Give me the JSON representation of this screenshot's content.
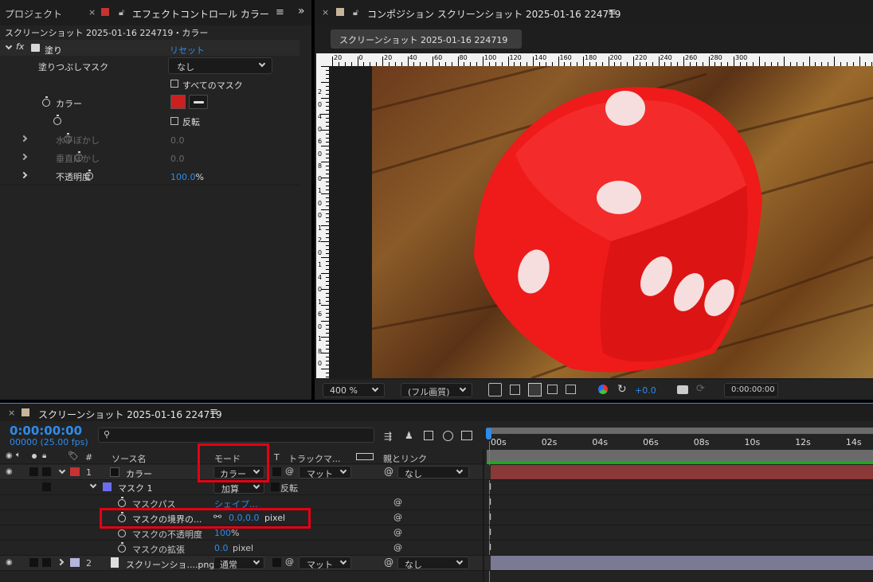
{
  "project_tab": "プロジェクト",
  "effect_tab": "エフェクトコントロール カラー",
  "effect_subtitle": "スクリーンショット 2025-01-16 224719・カラー",
  "effect": {
    "fx_label": "fx",
    "name": "塗り",
    "reset": "リセット",
    "fill_mask_label": "塗りつぶしマスク",
    "fill_mask_value": "なし",
    "all_masks": "すべてのマスク",
    "color_label": "カラー",
    "color_value": "#cc1f1f",
    "invert": "反転",
    "h_blur_label": "水平ぼかし",
    "h_blur_value": "0.0",
    "v_blur_label": "垂直ぼかし",
    "v_blur_value": "0.0",
    "opacity_label": "不透明度",
    "opacity_value": "100.0",
    "opacity_unit": "%"
  },
  "comp": {
    "tab": "コンポジション スクリーンショット 2025-01-16 224719",
    "flow_tab": "スクリーンショット 2025-01-16 224719",
    "ruler_h": [
      "20",
      "0",
      "20",
      "40",
      "60",
      "80",
      "100",
      "120",
      "140",
      "160",
      "180",
      "200",
      "220",
      "240",
      "260",
      "280",
      "300"
    ],
    "ruler_v": [
      "2",
      "0",
      "4",
      "0",
      "6",
      "0",
      "8",
      "0",
      "1",
      "0",
      "0",
      "1",
      "2",
      "0",
      "1",
      "4",
      "0",
      "1",
      "6",
      "0",
      "1",
      "8",
      "0"
    ],
    "zoom": "400 %",
    "quality": "(フル画質)",
    "exposure": "+0.0",
    "timecode": "0:00:00:00"
  },
  "timeline": {
    "tab": "スクリーンショット 2025-01-16 224719",
    "timecode": "0:00:00:00",
    "fps": "00000 (25.00 fps)",
    "search_placeholder": "",
    "ticks": [
      "00s",
      "02s",
      "04s",
      "06s",
      "08s",
      "10s",
      "12s",
      "14s"
    ],
    "col_hash": "#",
    "col_source": "ソース名",
    "col_mode": "モード",
    "col_t": "T",
    "col_track": "トラックマ...",
    "col_parent": "親とリンク",
    "layer1": {
      "num": "1",
      "name": "カラー",
      "mode": "カラー",
      "track": "マット",
      "parent": "なし",
      "color": "#c83232"
    },
    "mask1": {
      "name": "マスク 1",
      "mode": "加算",
      "invert": "反転",
      "color": "#6c6cf0"
    },
    "mask_path": {
      "label": "マスクパス",
      "value": "シェイプ..."
    },
    "mask_feather": {
      "label": "マスクの境界の...",
      "value": "0.0,0.0",
      "unit": "pixel"
    },
    "mask_opacity": {
      "label": "マスクの不透明度",
      "value": "100",
      "unit": "%"
    },
    "mask_expand": {
      "label": "マスクの拡張",
      "value": "0.0",
      "unit": "pixel"
    },
    "layer2": {
      "num": "2",
      "name": "スクリーンショ....png",
      "mode": "通常",
      "track": "マット",
      "parent": "なし",
      "color": "#b4b4dc"
    }
  }
}
